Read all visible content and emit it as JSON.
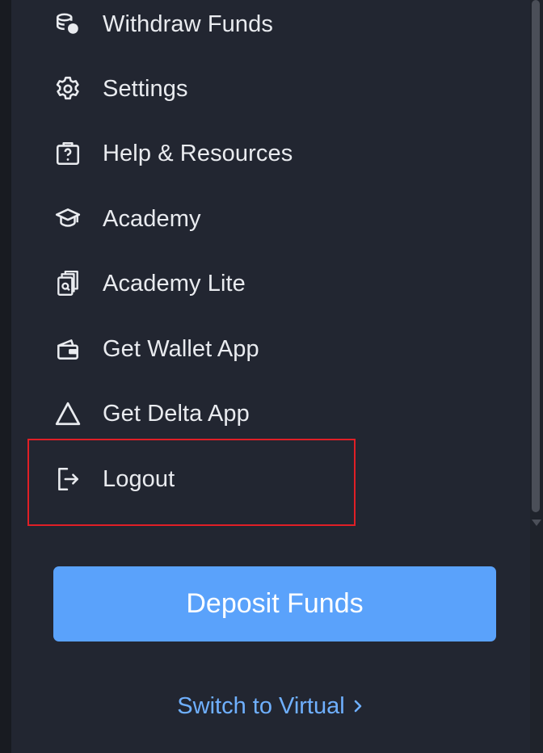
{
  "menu": {
    "items": [
      {
        "label": "Withdraw Funds",
        "icon": "coins-icon"
      },
      {
        "label": "Settings",
        "icon": "gear-icon"
      },
      {
        "label": "Help & Resources",
        "icon": "help-icon"
      },
      {
        "label": "Academy",
        "icon": "graduation-cap-icon"
      },
      {
        "label": "Academy Lite",
        "icon": "book-stack-icon"
      },
      {
        "label": "Get Wallet App",
        "icon": "wallet-icon"
      },
      {
        "label": "Get Delta App",
        "icon": "delta-triangle-icon"
      },
      {
        "label": "Logout",
        "icon": "logout-icon"
      }
    ]
  },
  "deposit_button": {
    "label": "Deposit Funds"
  },
  "switch_link": {
    "label": "Switch to Virtual"
  },
  "colors": {
    "panel_background": "#222631",
    "accent_blue": "#5aa2fb",
    "link_blue": "#6fb0ff",
    "highlight_red": "#e01f26",
    "text": "#e9ebef"
  }
}
